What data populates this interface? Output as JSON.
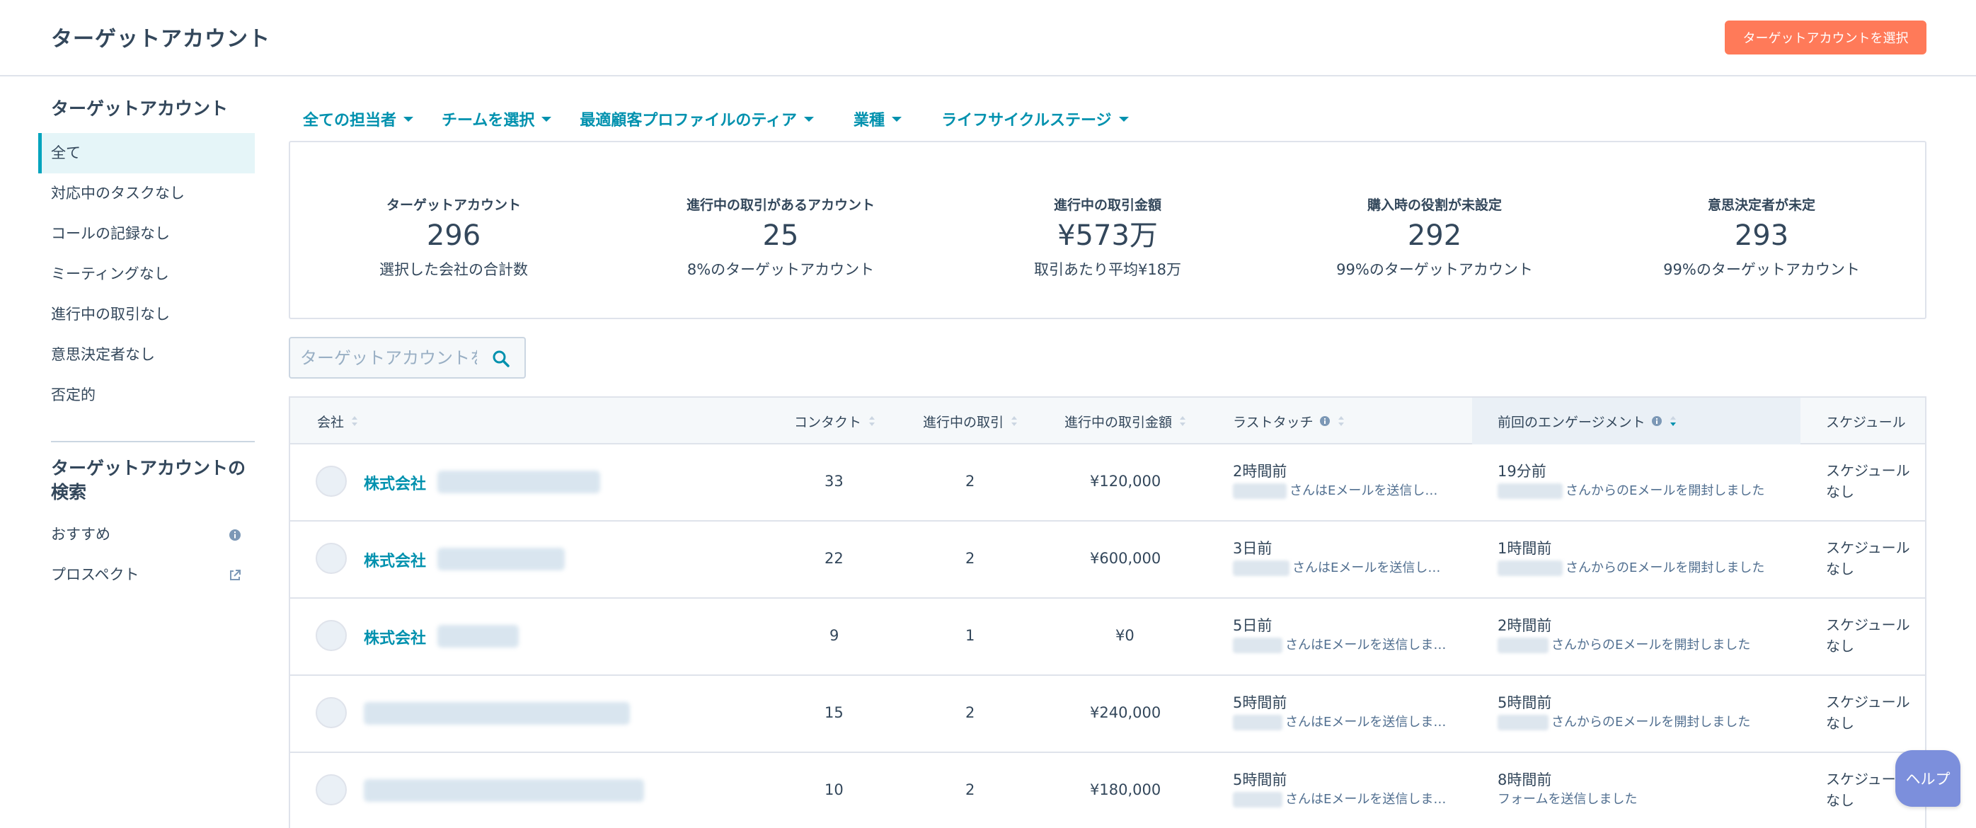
{
  "header": {
    "title": "ターゲットアカウント",
    "primary_button": "ターゲットアカウントを選択"
  },
  "sidebar": {
    "section_title": "ターゲットアカウント",
    "items": [
      {
        "label": "全て",
        "active": true
      },
      {
        "label": "対応中のタスクなし"
      },
      {
        "label": "コールの記録なし"
      },
      {
        "label": "ミーティングなし"
      },
      {
        "label": "進行中の取引なし"
      },
      {
        "label": "意思決定者なし"
      },
      {
        "label": "否定的"
      }
    ],
    "search_section_title": "ターゲットアカウントの検索",
    "search_items": [
      {
        "label": "おすすめ",
        "icon": "info-icon"
      },
      {
        "label": "プロスペクト",
        "icon": "external-link-icon"
      }
    ]
  },
  "filters": [
    {
      "label": "全ての担当者"
    },
    {
      "label": "チームを選択"
    },
    {
      "label": "最適顧客プロファイルのティア"
    },
    {
      "label": "業種"
    },
    {
      "label": "ライフサイクルステージ"
    }
  ],
  "kpis": [
    {
      "label": "ターゲットアカウント",
      "value": "296",
      "sub": "選択した会社の合計数"
    },
    {
      "label": "進行中の取引があるアカウント",
      "value": "25",
      "sub": "8%のターゲットアカウント"
    },
    {
      "label": "進行中の取引金額",
      "value": "¥573万",
      "sub": "取引あたり平均¥18万"
    },
    {
      "label": "購入時の役割が未設定",
      "value": "292",
      "sub": "99%のターゲットアカウント"
    },
    {
      "label": "意思決定者が未定",
      "value": "293",
      "sub": "99%のターゲットアカウント"
    }
  ],
  "search": {
    "placeholder": "ターゲットアカウントを"
  },
  "table": {
    "columns": {
      "company": "会社",
      "contacts": "コンタクト",
      "open_deals": "進行中の取引",
      "open_deal_amount": "進行中の取引金額",
      "last_touch": "ラストタッチ",
      "last_engagement": "前回のエンゲージメント",
      "schedule": "スケジュール"
    },
    "rows": [
      {
        "company": "株式会社",
        "contacts": "33",
        "deals": "2",
        "amount": "¥120,000",
        "last_touch_time": "2時間前",
        "last_touch_detail": "さんはEメールを送信し…",
        "engagement_time": "19分前",
        "engagement_detail": "さんからのEメールを開封しました",
        "schedule": "スケジュールなし"
      },
      {
        "company": "株式会社",
        "contacts": "22",
        "deals": "2",
        "amount": "¥600,000",
        "last_touch_time": "3日前",
        "last_touch_detail": "さんはEメールを送信し…",
        "engagement_time": "1時間前",
        "engagement_detail": "さんからのEメールを開封しました",
        "schedule": "スケジュールなし"
      },
      {
        "company": "株式会社",
        "contacts": "9",
        "deals": "1",
        "amount": "¥0",
        "last_touch_time": "5日前",
        "last_touch_detail": "さんはEメールを送信しま…",
        "engagement_time": "2時間前",
        "engagement_detail": "さんからのEメールを開封しました",
        "schedule": "スケジュールなし"
      },
      {
        "company": "",
        "contacts": "15",
        "deals": "2",
        "amount": "¥240,000",
        "last_touch_time": "5時間前",
        "last_touch_detail": "さんはEメールを送信しま…",
        "engagement_time": "5時間前",
        "engagement_detail": "さんからのEメールを開封しました",
        "schedule": "スケジュールなし"
      },
      {
        "company": "",
        "contacts": "10",
        "deals": "2",
        "amount": "¥180,000",
        "last_touch_time": "5時間前",
        "last_touch_detail": "さんはEメールを送信しま…",
        "engagement_time": "8時間前",
        "engagement_detail": "フォームを送信しました",
        "schedule": "スケジュールなし"
      }
    ]
  },
  "help_button": "ヘルプ",
  "colors": {
    "accent": "#0091ae",
    "primary_button": "#ff7a59",
    "text": "#33475b",
    "border": "#dfe3eb"
  }
}
